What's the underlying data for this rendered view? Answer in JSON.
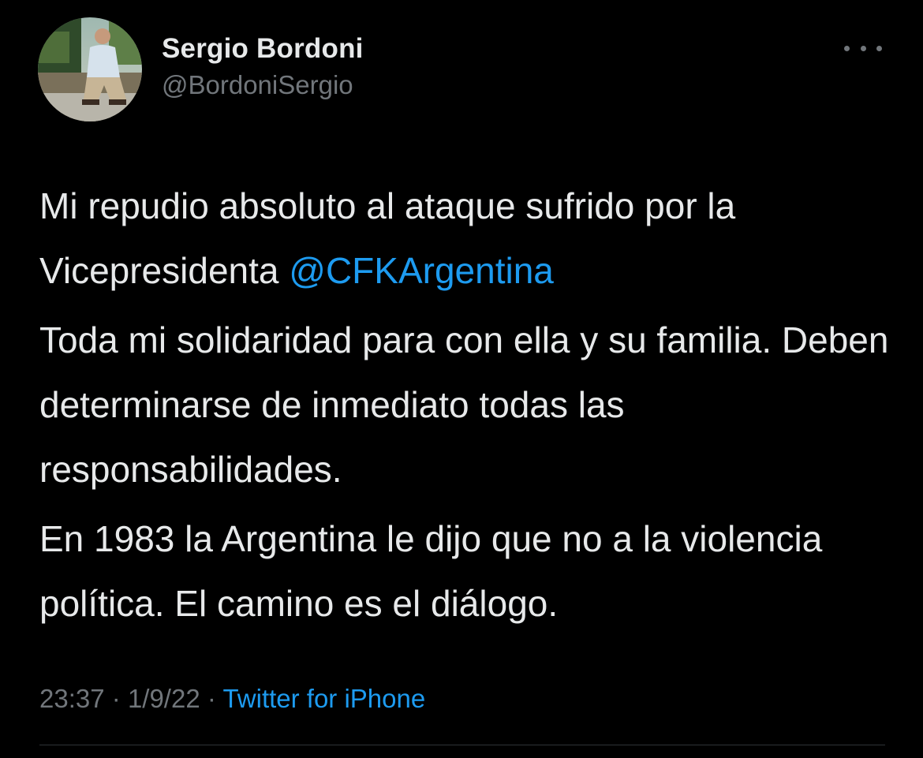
{
  "author": {
    "display_name": "Sergio Bordoni",
    "handle": "@BordoniSergio",
    "avatar_icon": "profile-photo"
  },
  "menu": {
    "icon": "more-options-icon"
  },
  "tweet": {
    "paragraph_1": {
      "text": "Mi repudio absoluto al ataque sufrido por la Vicepresidenta ",
      "mention": "@CFKArgentina"
    },
    "paragraph_2": "Toda mi solidaridad para con ella y su familia. Deben determinarse de inmediato todas las responsabilidades.",
    "paragraph_3": "En 1983 la Argentina le dijo que no a la violencia política. El camino es el diálogo."
  },
  "meta": {
    "time": "23:37",
    "separator": "·",
    "date": "1/9/22",
    "source": "Twitter for iPhone"
  },
  "colors": {
    "background": "#000000",
    "text": "#e7e9ea",
    "secondary": "#71767b",
    "accent": "#1d9bf0",
    "divider": "#2f3336"
  }
}
